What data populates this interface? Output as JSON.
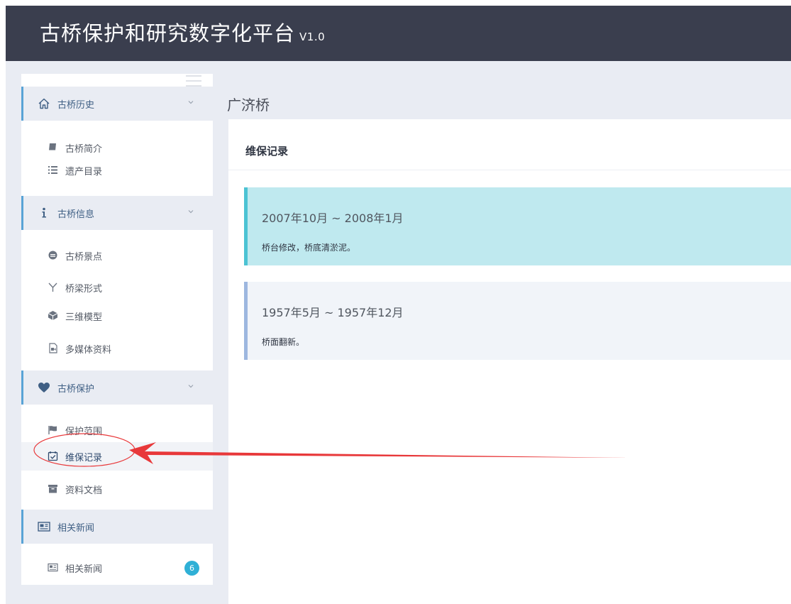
{
  "header": {
    "title": "古桥保护和研究数字化平台",
    "version": "V1.0"
  },
  "sidebar": {
    "sections": [
      {
        "label": "古桥历史",
        "icon": "home-icon",
        "items": [
          {
            "label": "古桥简介",
            "icon": "book-icon"
          },
          {
            "label": "遗产目录",
            "icon": "list-icon"
          }
        ]
      },
      {
        "label": "古桥信息",
        "icon": "info-icon",
        "items": [
          {
            "label": "古桥景点",
            "icon": "scenic-spot-icon"
          },
          {
            "label": "桥梁形式",
            "icon": "fork-icon"
          },
          {
            "label": "三维模型",
            "icon": "cube-icon"
          },
          {
            "label": "多媒体资料",
            "icon": "media-file-icon"
          }
        ]
      },
      {
        "label": "古桥保护",
        "icon": "heart-icon",
        "items": [
          {
            "label": "保护范围",
            "icon": "flag-icon"
          },
          {
            "label": "维保记录",
            "icon": "calendar-check-icon"
          },
          {
            "label": "资料文档",
            "icon": "archive-icon"
          }
        ]
      },
      {
        "label": "相关新闻",
        "icon": "newspaper-icon",
        "items": [
          {
            "label": "相关新闻",
            "icon": "newspaper-icon",
            "badge": "6"
          }
        ]
      }
    ]
  },
  "main": {
    "title": "广济桥",
    "panel_title": "维保记录",
    "records": [
      {
        "date": "2007年10月 ~ 2008年1月",
        "desc": "桥台修改，桥底清淤泥。"
      },
      {
        "date": "1957年5月 ~ 1957年12月",
        "desc": "桥面翻新。"
      }
    ]
  },
  "colors": {
    "header_bg": "#3a3e4e",
    "accent": "#59a3d6",
    "highlight": "#bfe9ef",
    "annotation": "#e8383a",
    "badge": "#2fb0d6"
  }
}
